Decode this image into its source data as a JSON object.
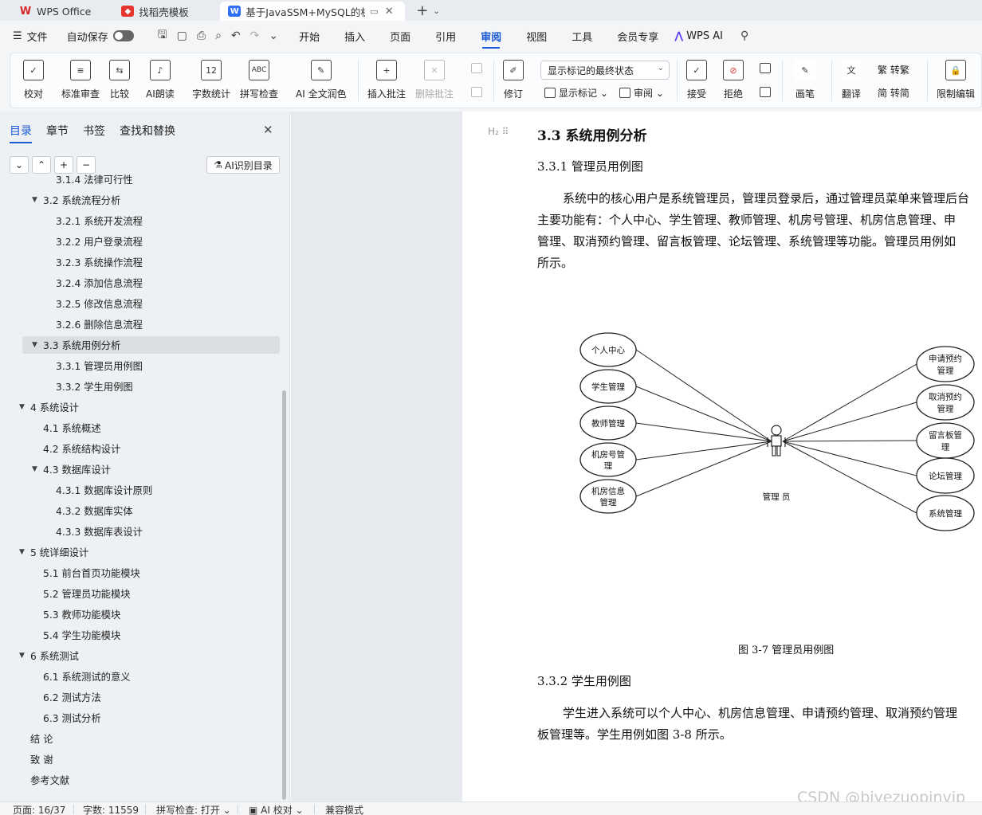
{
  "tabs": [
    {
      "label": "WPS Office"
    },
    {
      "label": "找稻壳模板"
    },
    {
      "label": "基于JavaSSM+MySQL的机房"
    }
  ],
  "menu": {
    "file": "文件",
    "autosave": "自动保存",
    "tabs": [
      "开始",
      "插入",
      "页面",
      "引用",
      "审阅",
      "视图",
      "工具",
      "会员专享"
    ],
    "active_tab": "审阅",
    "wps_ai": "WPS AI"
  },
  "ribbon": {
    "proofread": "校对",
    "standard_review": "标准审查",
    "compare": "比较",
    "ai_read": "AI朗读",
    "word_count": "字数统计",
    "spell_check": "拼写检查",
    "ai_polish": "AI 全文润色",
    "insert_comment": "插入批注",
    "delete_comment": "删除批注",
    "revise": "修订",
    "display_mode": "显示标记的最终状态",
    "show_marks": "显示标记",
    "review": "审阅",
    "accept": "接受",
    "reject": "拒绝",
    "pen": "画笔",
    "translate": "翻译",
    "to_traditional": "转繁",
    "to_simplified": "转简",
    "restrict_edit": "限制编辑"
  },
  "nav": {
    "tabs": [
      "目录",
      "章节",
      "书签",
      "查找和替换"
    ],
    "ai_toc": "AI识别目录",
    "toc": [
      {
        "label": "3.1.4  法律可行性",
        "level": 3
      },
      {
        "label": "3.2 系统流程分析",
        "level": 2,
        "expand": true
      },
      {
        "label": "3.2.1 系统开发流程",
        "level": 3
      },
      {
        "label": "3.2.2  用户登录流程",
        "level": 3
      },
      {
        "label": "3.2.3  系统操作流程",
        "level": 3
      },
      {
        "label": "3.2.4  添加信息流程",
        "level": 3
      },
      {
        "label": "3.2.5  修改信息流程",
        "level": 3
      },
      {
        "label": "3.2.6  删除信息流程",
        "level": 3
      },
      {
        "label": "3.3 系统用例分析",
        "level": 2,
        "expand": true,
        "selected": true
      },
      {
        "label": "3.3.1 管理员用例图",
        "level": 3
      },
      {
        "label": "3.3.2 学生用例图",
        "level": 3
      },
      {
        "label": "4  系统设计",
        "level": 1,
        "expand": true
      },
      {
        "label": "4.1  系统概述",
        "level": 2
      },
      {
        "label": "4.2  系统结构设计",
        "level": 2
      },
      {
        "label": "4.3 数据库设计",
        "level": 2,
        "expand": true
      },
      {
        "label": "4.3.1  数据库设计原则",
        "level": 3
      },
      {
        "label": "4.3.2  数据库实体",
        "level": 3
      },
      {
        "label": "4.3.3  数据库表设计",
        "level": 3
      },
      {
        "label": "5 统详细设计",
        "level": 1,
        "expand": true
      },
      {
        "label": "5.1 前台首页功能模块",
        "level": 2
      },
      {
        "label": "5.2 管理员功能模块",
        "level": 2
      },
      {
        "label": "5.3 教师功能模块",
        "level": 2
      },
      {
        "label": "5.4 学生功能模块",
        "level": 2
      },
      {
        "label": "6 系统测试",
        "level": 1,
        "expand": true
      },
      {
        "label": "6.1 系统测试的意义",
        "level": 2
      },
      {
        "label": "6.2  测试方法",
        "level": 2
      },
      {
        "label": "6.3 测试分析",
        "level": 2
      },
      {
        "label": "结    论",
        "level": 1
      },
      {
        "label": "致    谢",
        "level": 1
      },
      {
        "label": "参考文献",
        "level": 1
      }
    ]
  },
  "document": {
    "h2_marker": "H₂",
    "section_title": "3.3 系统用例分析",
    "sub1": "3.3.1 管理员用例图",
    "para1": [
      "系统中的核心用户是系统管理员，管理员登录后，通过管理员菜单来管理后台",
      "主要功能有：个人中心、学生管理、教师管理、机房号管理、机房信息管理、申",
      "管理、取消预约管理、留言板管理、论坛管理、系统管理等功能。管理员用例如",
      "所示。"
    ],
    "diagram": {
      "actor": "管理 员",
      "left": [
        [
          "个人中心"
        ],
        [
          "学生管理"
        ],
        [
          "教师管理"
        ],
        [
          "机房号管",
          "理"
        ],
        [
          "机房信息",
          "管理"
        ]
      ],
      "right": [
        [
          "申请预约",
          "管理"
        ],
        [
          "取消预约",
          "管理"
        ],
        [
          "留言板管",
          "理"
        ],
        [
          "论坛管理"
        ],
        [
          "系统管理"
        ]
      ]
    },
    "caption": "图 3-7 管理员用例图",
    "sub2": "3.3.2 学生用例图",
    "para2": [
      "学生进入系统可以个人中心、机房信息管理、申请预约管理、取消预约管理",
      "板管理等。学生用例如图 3-8 所示。"
    ]
  },
  "status": {
    "page": "页面: 16/37",
    "words": "字数: 11559",
    "spell": "拼写检查: 打开",
    "ai_proof": "AI 校对",
    "compat": "兼容模式"
  },
  "watermark": "CSDN @biyezuopinvip"
}
